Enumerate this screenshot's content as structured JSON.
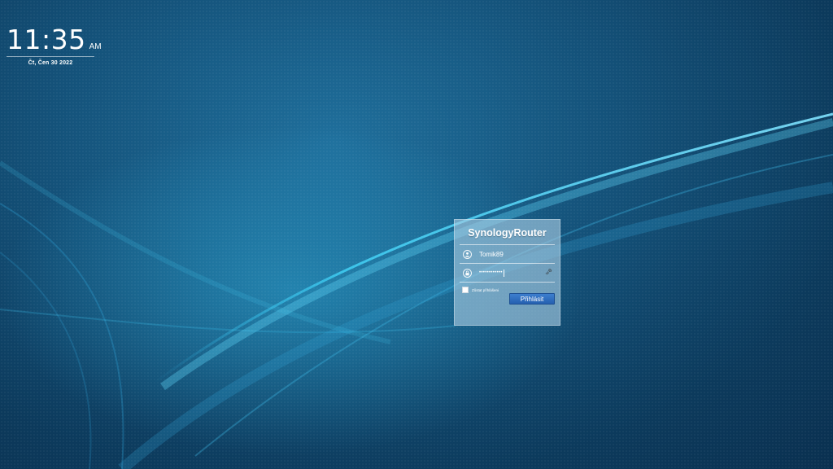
{
  "clock": {
    "time": "11:35",
    "ampm": "AM",
    "date": "Čt, Čen 30 2022"
  },
  "login": {
    "title": "SynologyRouter",
    "username": "Tomik89",
    "password_mask": "••••••••••••",
    "remember_label": "Zůstat přihlášeni",
    "remember_checked": false,
    "submit_label": "Přihlásit"
  },
  "icons": {
    "user": "user-icon",
    "lock": "lock-icon",
    "key": "key-icon"
  },
  "colors": {
    "background": "#14527a",
    "button": "#2d6cbf"
  }
}
